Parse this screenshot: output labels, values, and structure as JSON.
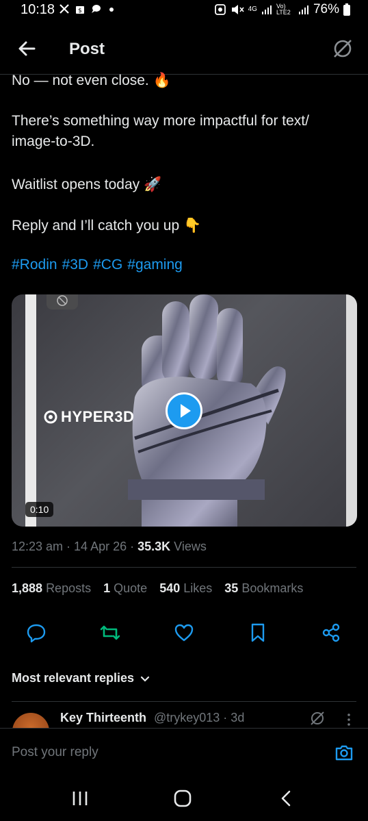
{
  "status_bar": {
    "time": "10:18",
    "network": "4G",
    "lte": "Vo) LTE2",
    "battery": "76%"
  },
  "header": {
    "title": "Post"
  },
  "post": {
    "lines": [
      "No — not even close. 🔥",
      "There’s something way more impactful for text/\nimage-to-3D.",
      "Waitlist opens today 🚀",
      "Reply and I’ll catch you up 👇"
    ],
    "hashtags": [
      "#Rodin",
      "#3D",
      "#CG",
      "#gaming"
    ],
    "media": {
      "brand": "HYPER3D",
      "duration": "0:10"
    },
    "timestamp": "12:23 am · 14 Apr 26 · ",
    "views_count": "35.3K",
    "views_label": " Views",
    "stats": {
      "reposts_count": "1,888",
      "reposts_label": "Reposts",
      "quotes_count": "1",
      "quotes_label": "Quote",
      "likes_count": "540",
      "likes_label": "Likes",
      "bookmarks_count": "35",
      "bookmarks_label": "Bookmarks"
    }
  },
  "replies": {
    "heading": "Most relevant replies",
    "first": {
      "name": "Key Thirteenth",
      "handle": "@trykey013 · 3d"
    }
  },
  "compose": {
    "placeholder": "Post your reply"
  },
  "colors": {
    "accent": "#1d9bf0",
    "retweet": "#00ba7c",
    "muted": "#71767b",
    "text": "#e7e9ea"
  }
}
